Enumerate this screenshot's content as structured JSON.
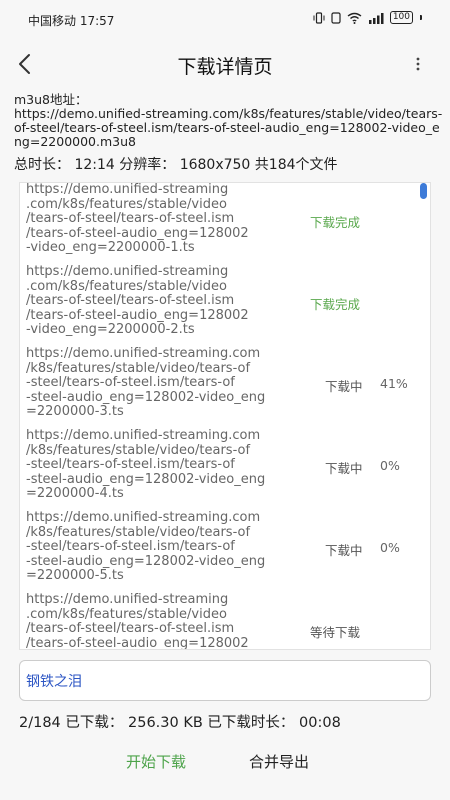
{
  "status_bar": {
    "carrier_time": "中国移动 17:57",
    "battery": "100"
  },
  "header": {
    "title": "下载详情页"
  },
  "info": {
    "m3u8_label": "m3u8地址：",
    "m3u8_url": "https://demo.unified-streaming.com/k8s/features/stable/video/tears-of-steel/tears-of-steel.ism/tears-of-steel-audio_eng=128002-video_eng=2200000.m3u8",
    "summary": "总时长： 12:14  分辨率： 1680x750  共184个文件"
  },
  "files": [
    {
      "url": "https://demo.unified-streaming\n.com/k8s/features/stable/video\n/tears-of-steel/tears-of-steel.ism\n/tears-of-steel-audio_eng=128002\n-video_eng=2200000-1.ts",
      "status": "下载完成",
      "percent": ""
    },
    {
      "url": "https://demo.unified-streaming\n.com/k8s/features/stable/video\n/tears-of-steel/tears-of-steel.ism\n/tears-of-steel-audio_eng=128002\n-video_eng=2200000-2.ts",
      "status": "下载完成",
      "percent": ""
    },
    {
      "url": "https://demo.unified-streaming.com\n/k8s/features/stable/video/tears-of\n-steel/tears-of-steel.ism/tears-of\n-steel-audio_eng=128002-video_eng\n=2200000-3.ts",
      "status": "下载中",
      "percent": "41%"
    },
    {
      "url": "https://demo.unified-streaming.com\n/k8s/features/stable/video/tears-of\n-steel/tears-of-steel.ism/tears-of\n-steel-audio_eng=128002-video_eng\n=2200000-4.ts",
      "status": "下载中",
      "percent": "0%"
    },
    {
      "url": "https://demo.unified-streaming.com\n/k8s/features/stable/video/tears-of\n-steel/tears-of-steel.ism/tears-of\n-steel-audio_eng=128002-video_eng\n=2200000-5.ts",
      "status": "下载中",
      "percent": "0%"
    },
    {
      "url": "https://demo.unified-streaming\n.com/k8s/features/stable/video\n/tears-of-steel/tears-of-steel.ism\n/tears-of-steel-audio_eng=128002",
      "status": "等待下载",
      "percent": ""
    }
  ],
  "name_input": {
    "value": "钢铁之泪"
  },
  "progress": {
    "text": "2/184  已下载：  256.30 KB  已下载时长：  00:08"
  },
  "actions": {
    "start_label": "开始下载",
    "merge_label": "合并导出"
  },
  "colors": {
    "done": "#5aa84d",
    "accent_blue": "#3d7bd8",
    "input_text": "#2d56c4"
  }
}
